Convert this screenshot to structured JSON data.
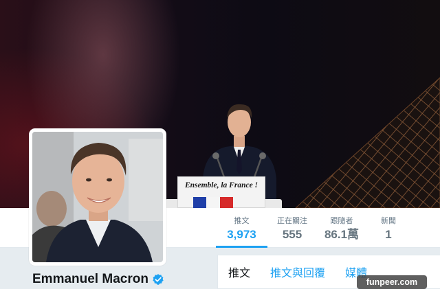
{
  "cover": {
    "lectern_slogan": "Ensemble, la France !",
    "flag_colors": [
      "#1f3fa8",
      "#f5f5f5",
      "#d62a2a"
    ]
  },
  "profile": {
    "display_name": "Emmanuel Macron",
    "verified": true
  },
  "stats": [
    {
      "label": "推文",
      "value": "3,973",
      "active": true
    },
    {
      "label": "正在關注",
      "value": "555",
      "active": false
    },
    {
      "label": "跟隨者",
      "value": "86.1萬",
      "active": false
    },
    {
      "label": "新聞",
      "value": "1",
      "active": false
    }
  ],
  "tabs": [
    {
      "label": "推文",
      "active": true
    },
    {
      "label": "推文與回覆",
      "active": false
    },
    {
      "label": "媒體",
      "active": false
    }
  ],
  "watermark": "funpeer.com",
  "colors": {
    "accent": "#1da1f2",
    "text_dark": "#14171a",
    "text_muted": "#657786",
    "page_bg": "#e6ecf0"
  }
}
